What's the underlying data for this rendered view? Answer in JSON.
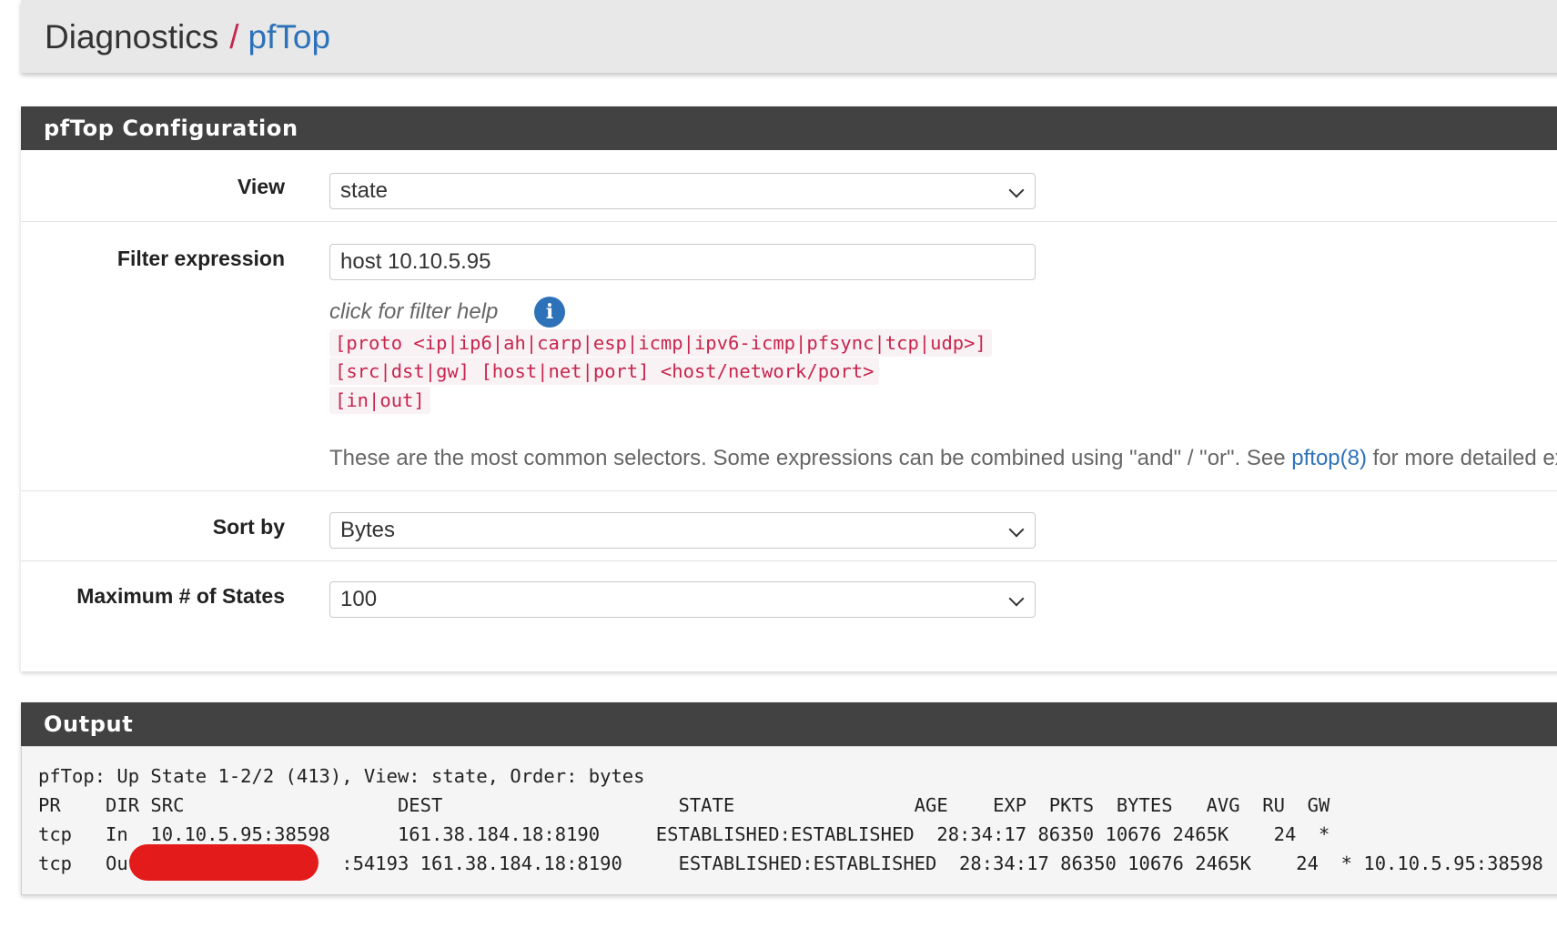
{
  "breadcrumb": {
    "root": "Diagnostics",
    "separator": "/",
    "current": "pfTop"
  },
  "config_panel": {
    "title": "pfTop Configuration",
    "view": {
      "label": "View",
      "value": "state"
    },
    "filter": {
      "label": "Filter expression",
      "value": "host 10.10.5.95",
      "help_link": "click for filter help",
      "code_lines": [
        "[proto <ip|ip6|ah|carp|esp|icmp|ipv6-icmp|pfsync|tcp|udp>]",
        "[src|dst|gw] [host|net|port] <host/network/port>",
        "[in|out]"
      ],
      "help_text_before": "These are the most common selectors. Some expressions can be combined using \"and\" / \"or\". See ",
      "help_text_link": "pftop(8)",
      "help_text_after": " for more detailed expression syntax."
    },
    "sort": {
      "label": "Sort by",
      "value": "Bytes"
    },
    "max_states": {
      "label": "Maximum # of States",
      "value": "100"
    }
  },
  "output_panel": {
    "title": "Output",
    "lines": [
      "pfTop: Up State 1-2/2 (413), View: state, Order: bytes",
      "PR    DIR SRC                   DEST                     STATE                AGE    EXP  PKTS  BYTES   AVG  RU  GW",
      "tcp   In  10.10.5.95:38598      161.38.184.18:8190     ESTABLISHED:ESTABLISHED  28:34:17 86350 10676 2465K    24  *",
      "tcp   Out                  :54193 161.38.184.18:8190     ESTABLISHED:ESTABLISHED  28:34:17 86350 10676 2465K    24  * 10.10.5.95:38598"
    ]
  },
  "colors": {
    "heading_bg": "#424242",
    "accent": "#2d72b8",
    "code_text": "#c7254e",
    "redaction": "#e31b1b"
  },
  "icons": {
    "info": "i",
    "chevron": "chevron-down-icon"
  }
}
